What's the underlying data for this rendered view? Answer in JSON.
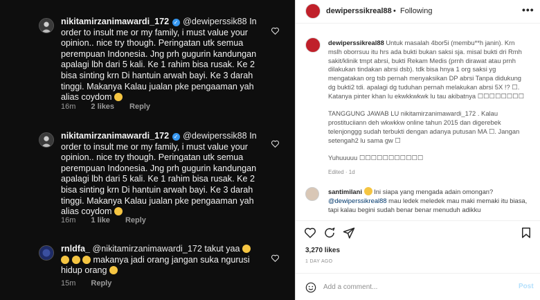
{
  "comments": [
    {
      "username": "nikitamirzanimawardi_172",
      "mention": "@dewiperssik88",
      "text": "In order to insult me or my family, i must value your opinion.. nice try though. Peringatan utk semua perempuan Indonesia. Jng prh gugurin kandungan apalagi lbh dari 5 kali. Ke 1 rahim bisa rusak. Ke 2 bisa sinting krn Di hantuin arwah bayi. Ke 3 darah tinggi. Makanya Kalau jualan pke pengaaman yah alias coydom",
      "time": "16m",
      "likes": "2 likes",
      "reply": "Reply"
    },
    {
      "username": "nikitamirzanimawardi_172",
      "mention": "@dewiperssik88",
      "text": "In order to insult me or my family, i must value your opinion.. nice try though. Peringatan utk semua perempuan Indonesia. Jng prh gugurin kandungan apalagi lbh dari 5 kali. Ke 1 rahim bisa rusak. Ke 2 bisa sinting krn Di hantuin arwah bayi. Ke 3 darah tinggi. Makanya Kalau jualan pke pengaaman yah alias coydom",
      "time": "16m",
      "likes": "1 like",
      "reply": "Reply"
    },
    {
      "username": "rnldfa_",
      "mention": "@nikitamirzanimawardi_172",
      "text": "takut yaa",
      "text2": "makanya jadi orang jangan suka ngurusi hidup orang",
      "time": "15m",
      "reply": "Reply"
    }
  ],
  "post": {
    "username": "dewiperssikreal88",
    "dot": "•",
    "following": "Following",
    "more": "•••",
    "caption_user": "dewiperssikreal88",
    "caption_p1": "Untuk masalah 4bor5i (membu**h janin). Krn mslh oborrsuu itu hrs ada bukti bukan saksi sja. misal bukti dri Rmh sakit/klinik tmpt abrsi, bukti Rekam Medis (prnh dirawat atau prnh dilakukan tindakan abrsi dsb). tdk bisa hnya 1 org saksi yg mengatakan org tsb pernah menyaksikan DP abrsi Tanpa didukung dg bukti2 tdi. apalagi dg tuduhan pernah melakukan abrsi 5X !? ☐. Katanya pinter khan lu ekwkkwkwk lu tau akibatnya ☐☐☐☐☐☐☐☐",
    "caption_p2": "TANGGUNG JAWAB LU nikitamirzanimawardi_172 . Kalau prostituciiann deh wkwkkw online tahun 2015 dan digerebek telenjonggg sudah terbukti dengan adanya putusan MA ☐. Jangan setengah2 lu sama gw ☐",
    "caption_p3": "Yuhuuuuu ☐☐☐☐☐☐☐☐☐☐☐",
    "edited": "Edited · 1d",
    "comment_user": "santimilani",
    "comment_text1": "Ini siapa yang mengada adain omongan?",
    "comment_mention": "@dewiperssikreal88",
    "comment_text2": "mau ledek meledek mau maki memaki itu biasa, tapi kalau begini sudah benar benar menuduh adikku",
    "likes": "3,270 likes",
    "ago": "1 DAY AGO",
    "add_placeholder": "Add a comment...",
    "post_label": "Post"
  },
  "colors": {
    "left_bg": "#0e0e0e",
    "verified": "#3797f0",
    "link": "#00376b",
    "post_btn": "#b2dffc"
  }
}
